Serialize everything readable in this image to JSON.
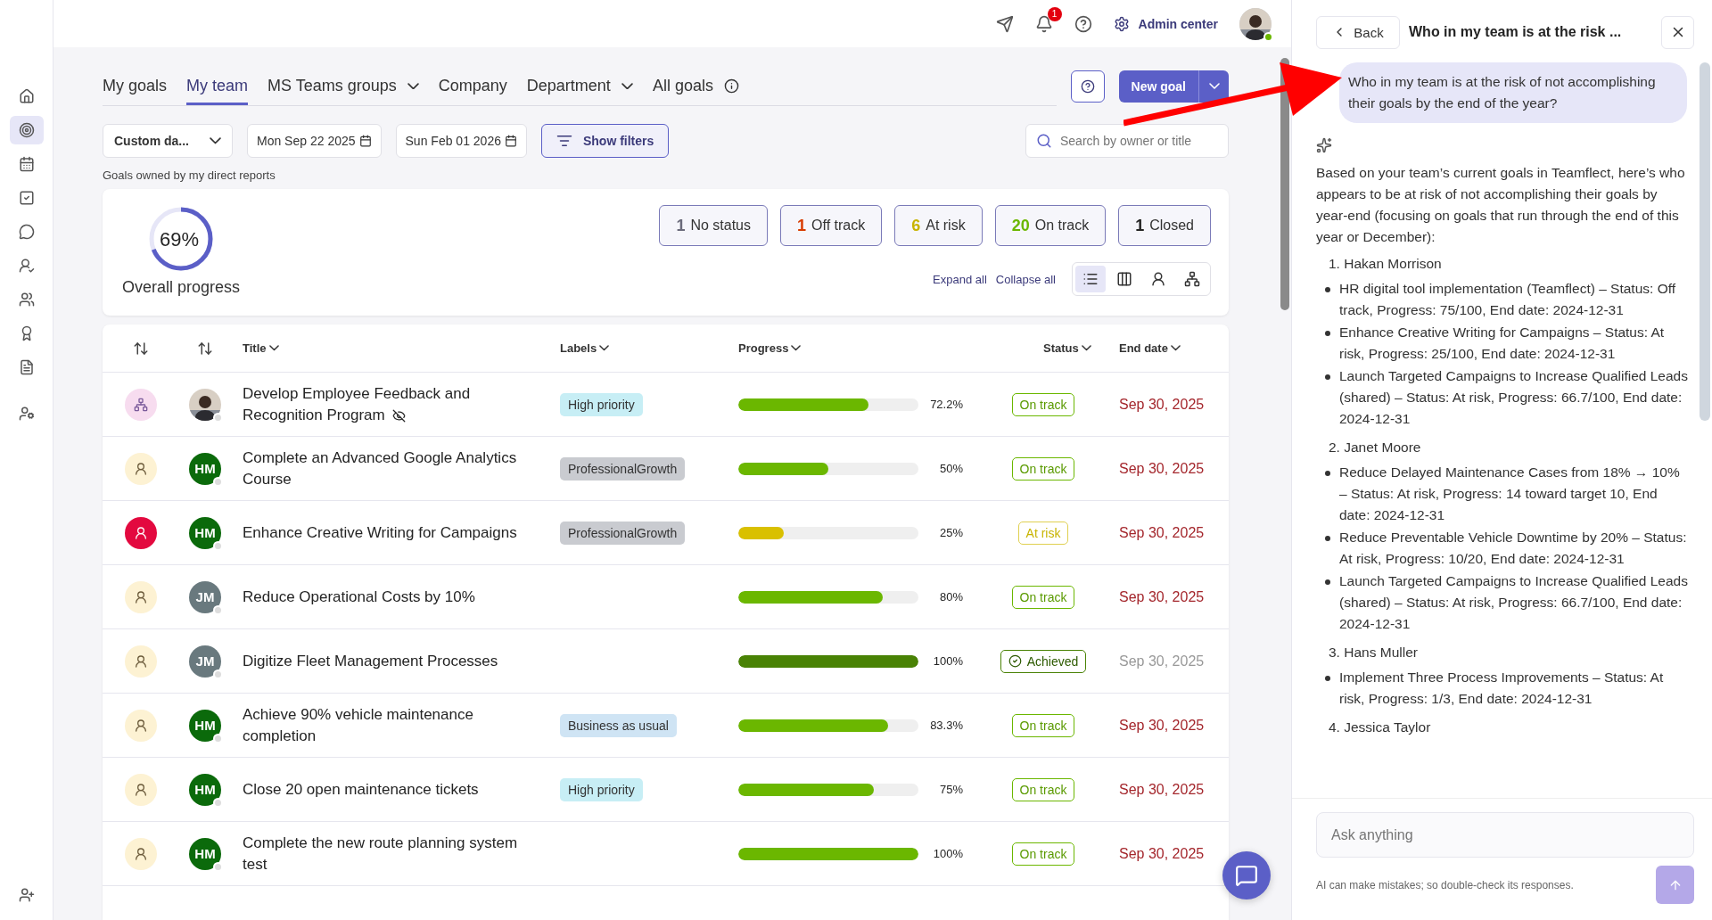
{
  "topbar": {
    "notifications": "1",
    "admin_label": "Admin center"
  },
  "tabs": [
    {
      "label": "My goals",
      "selected": false,
      "dropdown": false,
      "info": false
    },
    {
      "label": "My team",
      "selected": true,
      "dropdown": false,
      "info": false
    },
    {
      "label": "MS Teams groups",
      "selected": false,
      "dropdown": true,
      "info": false
    },
    {
      "label": "Company",
      "selected": false,
      "dropdown": false,
      "info": false
    },
    {
      "label": "Department",
      "selected": false,
      "dropdown": true,
      "info": false
    },
    {
      "label": "All goals",
      "selected": false,
      "dropdown": false,
      "info": true
    }
  ],
  "new_goal": "New goal",
  "filters": {
    "range": "Custom da...",
    "start": "Mon Sep 22 2025",
    "end": "Sun Feb 01 2026",
    "show_filters": "Show filters",
    "search_placeholder": "Search by owner or title"
  },
  "caption": "Goals owned by my direct reports",
  "summary": {
    "percent": "69%",
    "level": 0.69,
    "label": "Overall progress",
    "statuses": [
      {
        "count": "1",
        "label": "No status",
        "color": "#6b6b7b"
      },
      {
        "count": "1",
        "label": "Off track",
        "color": "#d83b01"
      },
      {
        "count": "6",
        "label": "At risk",
        "color": "#c8b400"
      },
      {
        "count": "20",
        "label": "On track",
        "color": "#6bb700"
      },
      {
        "count": "1",
        "label": "Closed",
        "color": "#242424"
      }
    ],
    "expand": "Expand all",
    "collapse": "Collapse all",
    "views": [
      {
        "kind": "list",
        "selected": true
      },
      {
        "kind": "board",
        "selected": false
      },
      {
        "kind": "person",
        "selected": false
      },
      {
        "kind": "tree",
        "selected": false
      }
    ]
  },
  "table": {
    "columns": [
      "Title",
      "Labels",
      "Progress",
      "Status",
      "End date"
    ],
    "rows": [
      {
        "owner": {
          "kind": "org"
        },
        "title": "Develop Employee Feedback and Recognition Program",
        "private": true,
        "label": {
          "text": "High priority",
          "color": "#c7eef5"
        },
        "level": 0.722,
        "reading": "72.2%",
        "status": {
          "label": "On track",
          "kind": "on_track"
        },
        "end": "Sep 30, 2025"
      },
      {
        "owner": {
          "kind": "person"
        },
        "avatar": {
          "kind": "initials",
          "initials": "HM",
          "color": "#0b6a0b"
        },
        "title": "Complete an Advanced Google Analytics Course",
        "private": false,
        "label": {
          "text": "ProfessionalGrowth",
          "color": "#c9cbd0"
        },
        "level": 0.5,
        "reading": "50%",
        "status": {
          "label": "On track",
          "kind": "on_track"
        },
        "end": "Sep 30, 2025"
      },
      {
        "owner": {
          "kind": "alert"
        },
        "avatar": {
          "kind": "initials",
          "initials": "HM",
          "color": "#0b6a0b"
        },
        "title": "Enhance Creative Writing for Campaigns",
        "private": false,
        "label": {
          "text": "ProfessionalGrowth",
          "color": "#c9cbd0"
        },
        "level": 0.25,
        "reading": "25%",
        "status": {
          "label": "At risk",
          "kind": "at_risk"
        },
        "end": "Sep 30, 2025"
      },
      {
        "owner": {
          "kind": "person"
        },
        "avatar": {
          "kind": "initials",
          "initials": "JM",
          "color": "#69797e"
        },
        "title": "Reduce Operational Costs by 10%",
        "private": false,
        "level": 0.8,
        "reading": "80%",
        "status": {
          "label": "On track",
          "kind": "on_track"
        },
        "end": "Sep 30, 2025"
      },
      {
        "owner": {
          "kind": "person"
        },
        "avatar": {
          "kind": "initials",
          "initials": "JM",
          "color": "#69797e"
        },
        "title": "Digitize Fleet Management Processes",
        "private": false,
        "level": 1,
        "reading": "100%",
        "status": {
          "label": "Achieved",
          "kind": "achieved"
        },
        "end": "Sep 30, 2025"
      },
      {
        "owner": {
          "kind": "person"
        },
        "avatar": {
          "kind": "initials",
          "initials": "HM",
          "color": "#0b6a0b"
        },
        "title": "Achieve 90% vehicle maintenance completion",
        "private": false,
        "label": {
          "text": "Business as usual",
          "color": "#cfe4f4"
        },
        "level": 0.833,
        "reading": "83.3%",
        "status": {
          "label": "On track",
          "kind": "on_track"
        },
        "end": "Sep 30, 2025"
      },
      {
        "owner": {
          "kind": "person"
        },
        "avatar": {
          "kind": "initials",
          "initials": "HM",
          "color": "#0b6a0b"
        },
        "title": "Close 20 open maintenance tickets",
        "private": false,
        "label": {
          "text": "High priority",
          "color": "#c7eef5"
        },
        "level": 0.75,
        "reading": "75%",
        "status": {
          "label": "On track",
          "kind": "on_track"
        },
        "end": "Sep 30, 2025"
      },
      {
        "owner": {
          "kind": "person"
        },
        "avatar": {
          "kind": "initials",
          "initials": "HM",
          "color": "#0b6a0b"
        },
        "title": "Complete the new route planning system test",
        "private": false,
        "level": 1,
        "reading": "100%",
        "status": {
          "label": "On track",
          "kind": "on_track"
        },
        "end": "Sep 30, 2025"
      }
    ]
  },
  "chat": {
    "back": "Back",
    "title": "Who in my team is at the risk ...",
    "question": "Who in my team is at the risk of not accomplishing their goals by the end of the year?",
    "intro": "Based on your team’s current goals in Teamflect, here’s who appears to be at risk of not accomplishing their goals by year-end (focusing on goals that run through the end of this year or December):",
    "people": [
      {
        "number": "1.",
        "name": "Hakan Morrison",
        "goals": [
          "HR digital tool implementation (Teamflect) – Status: Off track, Progress: 75/100, End date: 2024-12-31",
          "Enhance Creative Writing for Campaigns – Status: At risk, Progress: 25/100, End date: 2024-12-31",
          "Launch Targeted Campaigns to Increase Qualified Leads (shared) – Status: At risk, Progress: 66.7/100, End date: 2024-12-31"
        ]
      },
      {
        "number": "2.",
        "name": "Janet Moore",
        "goals": [
          "Reduce Delayed Maintenance Cases from 18% → 10% – Status: At risk, Progress: 14 toward target 10, End date: 2024-12-31",
          "Reduce Preventable Vehicle Downtime by 20% – Status: At risk, Progress: 10/20, End date: 2024-12-31",
          "Launch Targeted Campaigns to Increase Qualified Leads (shared) – Status: At risk, Progress: 66.7/100, End date: 2024-12-31"
        ]
      },
      {
        "number": "3.",
        "name": "Hans Muller",
        "goals": [
          "Implement Three Process Improvements – Status: At risk, Progress: 1/3, End date: 2024-12-31"
        ]
      },
      {
        "number": "4.",
        "name": "Jessica Taylor"
      }
    ],
    "input_placeholder": "Ask anything",
    "disclaimer": "AI can make mistakes; so double-check its responses."
  }
}
